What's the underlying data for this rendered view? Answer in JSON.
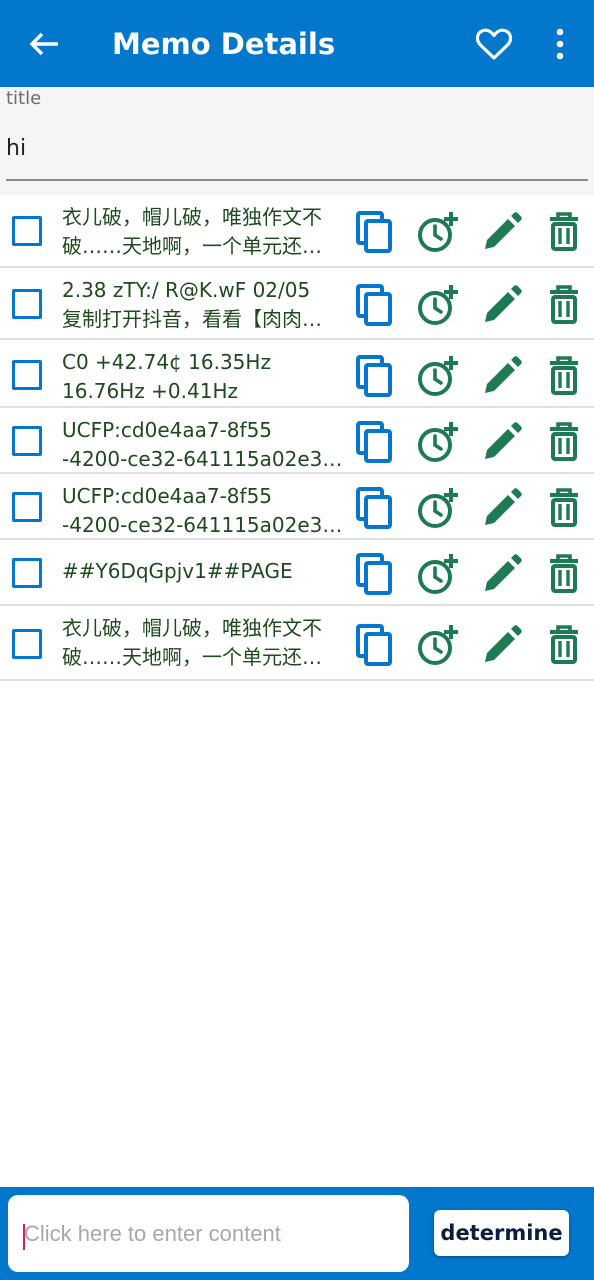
{
  "header": {
    "title": "Memo Details",
    "icons": {
      "back": "arrow-left-icon",
      "favorite": "heart-outline-icon",
      "more": "more-vertical-icon"
    }
  },
  "title_field": {
    "label": "title",
    "value": "hi"
  },
  "memos": [
    {
      "lines": [
        "衣儿破，帽儿破，唯独作文不",
        "破……天地啊，一个单元还…"
      ]
    },
    {
      "lines": [
        "2.38 zTY:/ R@K.wF 02/05",
        "复制打开抖音，看看【肉肉…"
      ]
    },
    {
      "lines": [
        "C0 +42.74¢ 16.35Hz",
        "16.76Hz +0.41Hz"
      ]
    },
    {
      "lines": [
        "UCFP:cd0e4aa7-8f55",
        "-4200-ce32-641115a02e3…"
      ]
    },
    {
      "lines": [
        "UCFP:cd0e4aa7-8f55",
        "-4200-ce32-641115a02e3…"
      ]
    },
    {
      "lines": [
        "##Y6DqGpjv1##PAGE"
      ]
    },
    {
      "lines": [
        "衣儿破，帽儿破，唯独作文不",
        "破……天地啊，一个单元还…"
      ]
    }
  ],
  "row_icons": {
    "copy": "copy-icon",
    "reminder": "alarm-add-icon",
    "edit": "pencil-icon",
    "delete": "trash-icon"
  },
  "colors": {
    "primary": "#0277cc",
    "action_green": "#1e7a54",
    "text_green": "#1e4a1e"
  },
  "bottom_bar": {
    "placeholder": "Click here to enter content",
    "value": "",
    "button_label": "determine"
  }
}
